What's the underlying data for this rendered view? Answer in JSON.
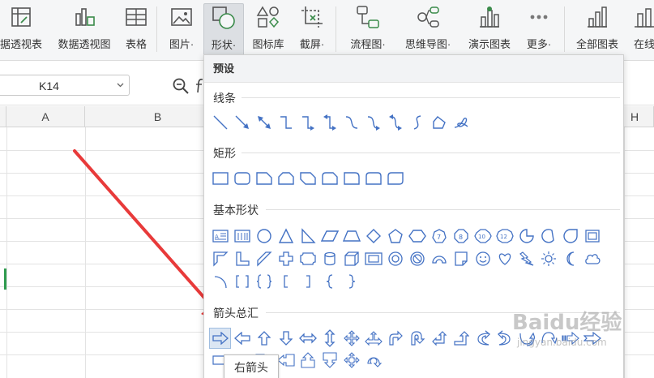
{
  "ribbon": {
    "buttons": [
      {
        "label": "据透视表",
        "icon": "pivot-table-icon"
      },
      {
        "label": "数据透视图",
        "icon": "pivot-chart-icon"
      },
      {
        "label": "表格",
        "icon": "table-icon"
      },
      {
        "label": "图片·",
        "icon": "picture-icon"
      },
      {
        "label": "形状·",
        "icon": "shape-icon"
      },
      {
        "label": "图标库",
        "icon": "icon-library-icon"
      },
      {
        "label": "截屏·",
        "icon": "screenshot-icon"
      },
      {
        "label": "流程图·",
        "icon": "flowchart-icon"
      },
      {
        "label": "思维导图·",
        "icon": "mindmap-icon"
      },
      {
        "label": "演示图表",
        "icon": "demo-chart-icon"
      },
      {
        "label": "更多·",
        "icon": "more-icon"
      },
      {
        "label": "全部图表",
        "icon": "all-charts-icon"
      },
      {
        "label": "在线",
        "icon": "online-icon"
      }
    ]
  },
  "formula_bar": {
    "name_box": "K14"
  },
  "grid": {
    "columns": [
      "A",
      "B",
      "H"
    ]
  },
  "shape_menu": {
    "header": "预设",
    "sections": {
      "lines": "线条",
      "rectangles": "矩形",
      "basic": "基本形状",
      "arrows": "箭头总汇"
    },
    "tooltip": "右箭头"
  },
  "colors": {
    "accent": "#4472c4",
    "annotation_arrow": "#e83a3a"
  },
  "watermark": "Baidu经验 jingyan.baidu.com"
}
